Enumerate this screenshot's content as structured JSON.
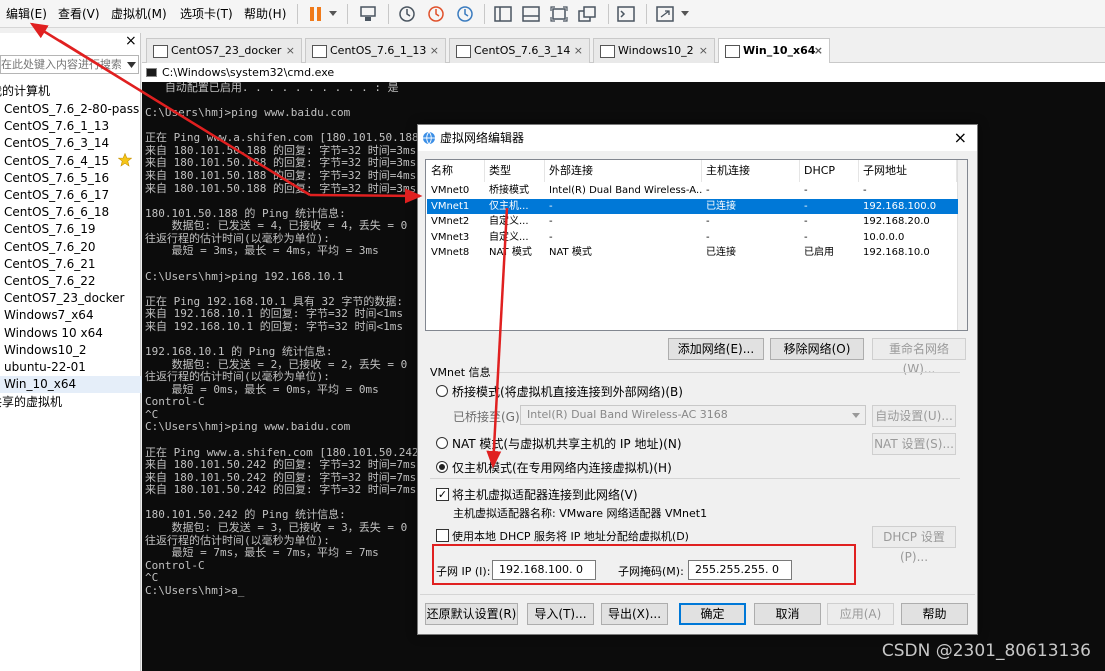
{
  "menubar": {
    "items": [
      "编辑(E)",
      "查看(V)",
      "虚拟机(M)",
      "选项卡(T)",
      "帮助(H)"
    ]
  },
  "library": {
    "search_placeholder": "在此处键入内容进行搜索",
    "root_label": "我的计算机",
    "vms": [
      "CentOS_7.6_2-80-pass",
      "CentOS_7.6_1_13",
      "CentOS_7.6_3_14",
      "CentOS_7.6_4_15",
      "CentOS_7.6_5_16",
      "CentOS_7.6_6_17",
      "CentOS_7.6_6_18",
      "CentOS_7.6_19",
      "CentOS_7.6_20",
      "CentOS_7.6_21",
      "CentOS_7.6_22",
      "CentOS7_23_docker",
      "Windows7_x64",
      "Windows 10 x64",
      "Windows10_2",
      "ubuntu-22-01",
      "Win_10_x64"
    ],
    "shared_label": "共享的虚拟机",
    "close_glyph": "×"
  },
  "tabs": [
    "CentOS7_23_docker",
    "CentOS_7.6_1_13",
    "CentOS_7.6_3_14",
    "Windows10_2",
    "Win_10_x64"
  ],
  "console": {
    "title": "C:\\Windows\\system32\\cmd.exe",
    "lines": [
      "   自动配置已启用. . . . . . . . . . : 是",
      "",
      "C:\\Users\\hmj>ping www.baidu.com",
      "",
      "正在 Ping www.a.shifen.com [180.101.50.188]",
      "来自 180.101.50.188 的回复: 字节=32 时间=3ms",
      "来自 180.101.50.188 的回复: 字节=32 时间=3ms",
      "来自 180.101.50.188 的回复: 字节=32 时间=4ms",
      "来自 180.101.50.188 的回复: 字节=32 时间=3ms",
      "",
      "180.101.50.188 的 Ping 统计信息:",
      "    数据包: 已发送 = 4，已接收 = 4，丢失 = 0",
      "往返行程的估计时间(以毫秒为单位):",
      "    最短 = 3ms，最长 = 4ms，平均 = 3ms",
      "",
      "C:\\Users\\hmj>ping 192.168.10.1",
      "",
      "正在 Ping 192.168.10.1 具有 32 字节的数据:",
      "来自 192.168.10.1 的回复: 字节=32 时间<1ms",
      "来自 192.168.10.1 的回复: 字节=32 时间<1ms",
      "",
      "192.168.10.1 的 Ping 统计信息:",
      "    数据包: 已发送 = 2，已接收 = 2，丢失 = 0",
      "往返行程的估计时间(以毫秒为单位):",
      "    最短 = 0ms，最长 = 0ms，平均 = 0ms",
      "Control-C",
      "^C",
      "C:\\Users\\hmj>ping www.baidu.com",
      "",
      "正在 Ping www.a.shifen.com [180.101.50.242]",
      "来自 180.101.50.242 的回复: 字节=32 时间=7ms",
      "来自 180.101.50.242 的回复: 字节=32 时间=7ms",
      "来自 180.101.50.242 的回复: 字节=32 时间=7ms",
      "",
      "180.101.50.242 的 Ping 统计信息:",
      "    数据包: 已发送 = 3，已接收 = 3，丢失 = 0",
      "往返行程的估计时间(以毫秒为单位):",
      "    最短 = 7ms，最长 = 7ms，平均 = 7ms",
      "Control-C",
      "^C",
      "C:\\Users\\hmj>a_"
    ]
  },
  "dialog": {
    "title": "虚拟网络编辑器",
    "close_glyph": "×",
    "table": {
      "headers": [
        "名称",
        "类型",
        "外部连接",
        "主机连接",
        "DHCP",
        "子网地址"
      ],
      "rows": [
        [
          "VMnet0",
          "桥接模式",
          "Intel(R) Dual Band Wireless-A...",
          "-",
          "-",
          "-"
        ],
        [
          "VMnet1",
          "仅主机...",
          "-",
          "已连接",
          "-",
          "192.168.100.0"
        ],
        [
          "VMnet2",
          "自定义...",
          "-",
          "-",
          "-",
          "192.168.20.0"
        ],
        [
          "VMnet3",
          "自定义...",
          "-",
          "-",
          "-",
          "10.0.0.0"
        ],
        [
          "VMnet8",
          "NAT 模式",
          "NAT 模式",
          "已连接",
          "已启用",
          "192.168.10.0"
        ]
      ],
      "selected_row": 1
    },
    "buttons_top": {
      "add": "添加网络(E)...",
      "remove": "移除网络(O)",
      "rename": "重命名网络(W)..."
    },
    "info_label": "VMnet 信息",
    "bridge_radio": "桥接模式(将虚拟机直接连接到外部网络)(B)",
    "bridged_to_label": "已桥接至(G):",
    "bridged_to_value": "Intel(R) Dual Band Wireless-AC 3168",
    "auto_setting": "自动设置(U)...",
    "nat_radio": "NAT 模式(与虚拟机共享主机的 IP 地址)(N)",
    "nat_setting": "NAT 设置(S)...",
    "hostonly_radio": "仅主机模式(在专用网络内连接虚拟机)(H)",
    "connect_adapter": "将主机虚拟适配器连接到此网络(V)",
    "adapter_name": "主机虚拟适配器名称: VMware 网络适配器 VMnet1",
    "dhcp_check": "使用本地 DHCP 服务将 IP 地址分配给虚拟机(D)",
    "dhcp_setting": "DHCP 设置(P)...",
    "subnet_ip_label": "子网 IP (I):",
    "subnet_ip": "192.168.100. 0",
    "subnet_mask_label": "子网掩码(M):",
    "subnet_mask": "255.255.255. 0",
    "bottom_buttons": {
      "restore": "还原默认设置(R)",
      "import": "导入(T)...",
      "export": "导出(X)...",
      "ok": "确定",
      "cancel": "取消",
      "apply": "应用(A)",
      "help": "帮助"
    }
  },
  "watermark": "CSDN @2301_80613136",
  "colors": {
    "annotation": "#e02020",
    "selection": "#0078d7"
  }
}
